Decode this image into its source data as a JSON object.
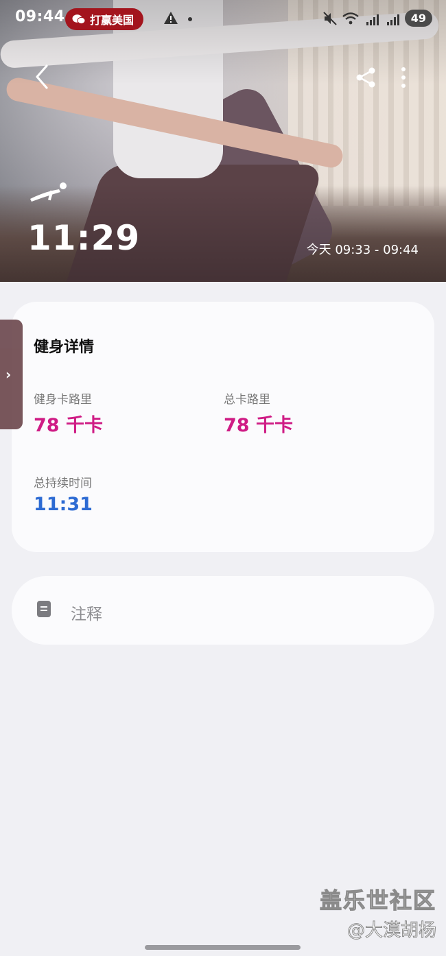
{
  "status_bar": {
    "time": "09:44",
    "notification_pill": "打赢美国",
    "battery": "49"
  },
  "hero": {
    "duration": "11:29",
    "time_range": "今天 09:33 - 09:44"
  },
  "details_card": {
    "title": "健身详情",
    "stats": [
      {
        "label": "健身卡路里",
        "value": "78 千卡"
      },
      {
        "label": "总卡路里",
        "value": "78 千卡"
      },
      {
        "label": "总持续时间",
        "value": "11:31"
      }
    ]
  },
  "notes_card": {
    "label": "注释"
  },
  "watermark": {
    "line1": "盖乐世社区",
    "line2": "@大漠胡杨"
  },
  "colors": {
    "calorie_accent": "#cf1c85",
    "duration_accent": "#2d6bd3",
    "page_background": "#f0f0f4"
  }
}
